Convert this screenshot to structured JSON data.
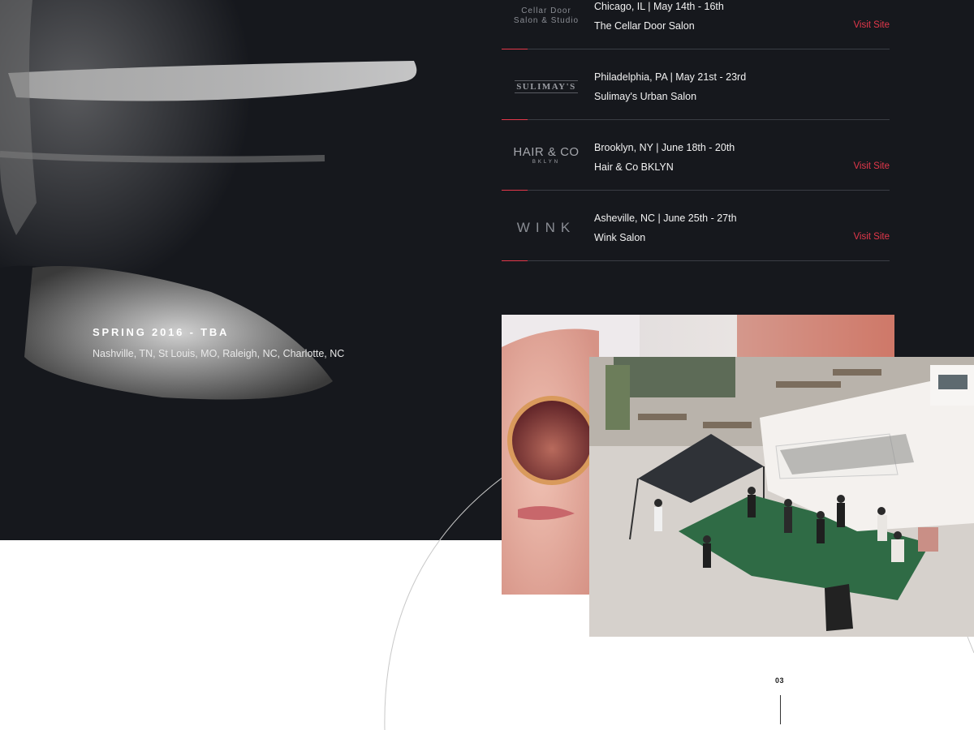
{
  "tour": {
    "title": "SPRING 2016 - TBA",
    "cities": "Nashville, TN, St Louis, MO, Raleigh, NC, Charlotte, NC"
  },
  "salons": [
    {
      "logo_text_1": "Cellar Door",
      "logo_text_2": "Salon & Studio",
      "date": "Chicago, IL | May 14th - 16th",
      "name": "The Cellar Door Salon",
      "link": "Visit Site"
    },
    {
      "logo_text_1": "SULIMAY'S",
      "date": "Philadelphia, PA | May 21st - 23rd",
      "name": "Sulimay's Urban Salon",
      "link": ""
    },
    {
      "logo_text_1": "HAIR & CO",
      "logo_text_2": "BKLYN",
      "date": "Brooklyn, NY | June 18th - 20th",
      "name": "Hair & Co BKLYN",
      "link": "Visit Site"
    },
    {
      "logo_text_1": "WINK",
      "date": "Asheville, NC | June 25th - 27th",
      "name": "Wink Salon",
      "link": "Visit Site"
    }
  ],
  "page": {
    "number": "03"
  },
  "colors": {
    "background_dark": "#16181d",
    "accent": "#e4384b",
    "divider": "#3a3d44"
  }
}
